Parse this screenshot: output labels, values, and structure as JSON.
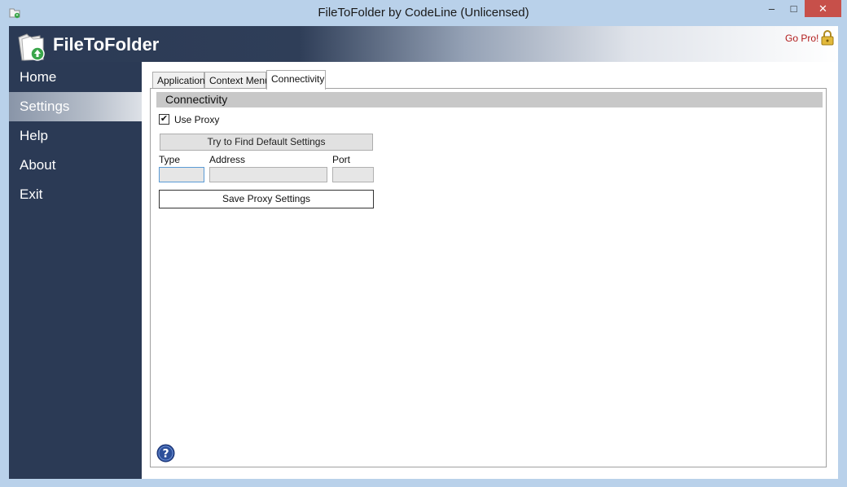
{
  "window": {
    "title": "FileToFolder by CodeLine (Unlicensed)",
    "minimize_glyph": "–",
    "maximize_glyph": "□",
    "close_glyph": "✕"
  },
  "header": {
    "brand": "FileToFolder",
    "go_pro": "Go Pro!"
  },
  "sidebar": {
    "items": [
      {
        "label": "Home",
        "active": false
      },
      {
        "label": "Settings",
        "active": true
      },
      {
        "label": "Help",
        "active": false
      },
      {
        "label": "About",
        "active": false
      },
      {
        "label": "Exit",
        "active": false
      }
    ]
  },
  "tabs": [
    {
      "label": "Application",
      "active": false
    },
    {
      "label": "Context Menu",
      "active": false
    },
    {
      "label": "Connectivity",
      "active": true
    }
  ],
  "connectivity": {
    "section_title": "Connectivity",
    "use_proxy_label": "Use Proxy",
    "use_proxy_checked": true,
    "check_glyph": "✔",
    "find_defaults_label": "Try to Find Default Settings",
    "type_label": "Type",
    "type_value": "",
    "address_label": "Address",
    "address_value": "",
    "port_label": "Port",
    "port_value": "",
    "save_label": "Save Proxy Settings"
  },
  "colors": {
    "sidebar_bg": "#2b3a55",
    "window_frame": "#b9d1ea",
    "go_pro": "#b11b1b",
    "help_icon": "#2c4f9a"
  },
  "icons": {
    "app": "folder-refresh-icon",
    "lock": "lock-icon",
    "help": "question-circle-icon"
  }
}
